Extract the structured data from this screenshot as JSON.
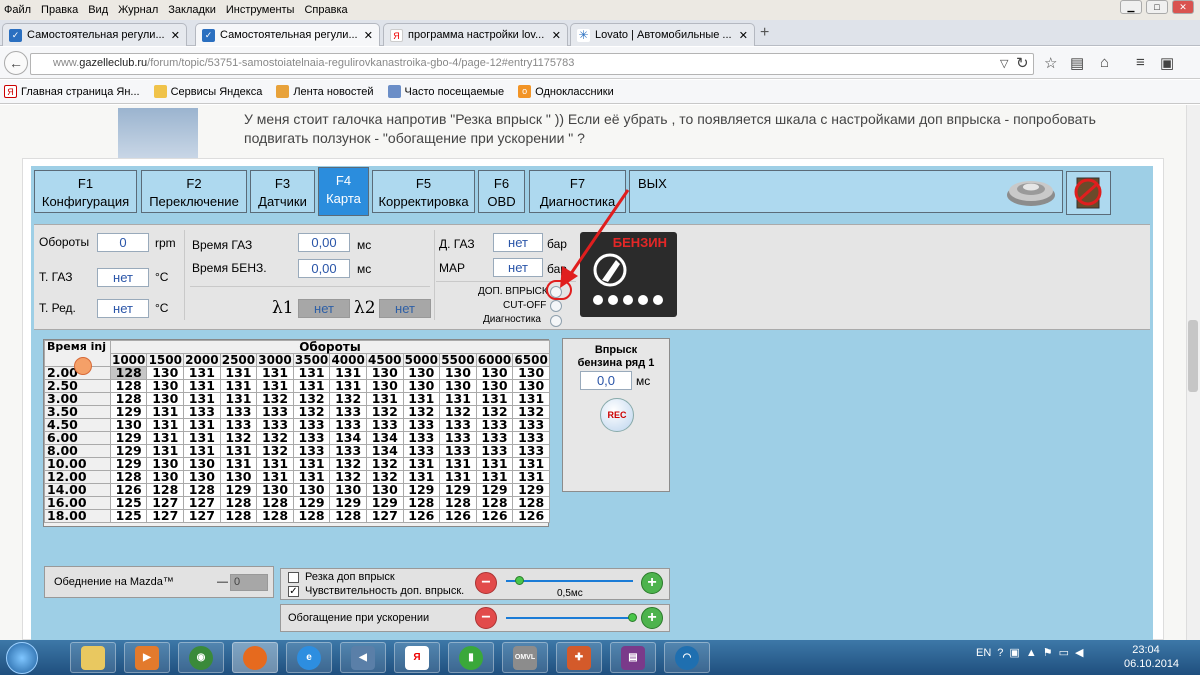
{
  "menubar": {
    "items": [
      "Файл",
      "Правка",
      "Вид",
      "Журнал",
      "Закладки",
      "Инструменты",
      "Справка"
    ]
  },
  "tabs": [
    {
      "title": "Самостоятельная регули...",
      "icon": "gazelle-favicon"
    },
    {
      "title": "Самостоятельная регули...",
      "icon": "gazelle-favicon"
    },
    {
      "title": "программа настройки lov...",
      "icon": "yandex-favicon"
    },
    {
      "title": "Lovato | Автомобильные ...",
      "icon": "lovato-favicon"
    }
  ],
  "url": {
    "prefix": "www.",
    "domain": "gazelleclub.ru",
    "path": "/forum/topic/53751-samostoiatelnaia-regulirovkanastroika-gbo-4/page-12#entry1175783"
  },
  "bookmarks": [
    "Главная страница Ян...",
    "Сервисы Яндекса",
    "Лента новостей",
    "Часто посещаемые",
    "Одноклассники"
  ],
  "forum": {
    "text": "У меня стоит галочка напротив \"Резка впрыск \" )) Если её убрать , то появляется шкала с настройками доп впрыска - попробовать подвигать ползунок - \"обогащение при ускорении \" ?"
  },
  "ftabs": [
    {
      "key": "F1",
      "label": "Конфигурация"
    },
    {
      "key": "F2",
      "label": "Переключение"
    },
    {
      "key": "F3",
      "label": "Датчики"
    },
    {
      "key": "F4",
      "label": "Карта"
    },
    {
      "key": "F5",
      "label": "Корректировка"
    },
    {
      "key": "F6",
      "label": "OBD"
    },
    {
      "key": "F7",
      "label": "Диагностика"
    },
    {
      "key": "",
      "label": "ВЫХ"
    }
  ],
  "panel": {
    "rpm_label": "Обороты",
    "rpm_value": "0",
    "rpm_unit": "rpm",
    "tgaz_label": "Т. ГАЗ",
    "tgaz_value": "нет",
    "tgaz_unit": "°C",
    "tred_label": "Т. Ред.",
    "tred_value": "нет",
    "tred_unit": "°C",
    "vgaz_label": "Время ГАЗ",
    "vgaz_value": "0,00",
    "vgaz_unit": "мс",
    "vbenz_label": "Время БЕНЗ.",
    "vbenz_value": "0,00",
    "vbenz_unit": "мс",
    "lambda1_label": "λ1",
    "lambda1_value": "нет",
    "lambda2_label": "λ2",
    "lambda2_value": "нет",
    "dgaz_label": "Д. ГАЗ",
    "dgaz_value": "нет",
    "dgaz_unit": "бар",
    "map_label": "MAP",
    "map_value": "нет",
    "map_unit": "бар",
    "ind1": "ДОП. ВПРЫСК",
    "ind2": "CUT-OFF",
    "ind3": "Диагностика",
    "fuel_badge": "БЕНЗИН"
  },
  "map": {
    "corner": "Время inj",
    "rpm_header": "Обороты",
    "rpm": [
      "1000",
      "1500",
      "2000",
      "2500",
      "3000",
      "3500",
      "4000",
      "4500",
      "5000",
      "5500",
      "6000",
      "6500"
    ],
    "rows": [
      {
        "t": "2.00",
        "v": [
          "128",
          "130",
          "131",
          "131",
          "131",
          "131",
          "131",
          "130",
          "130",
          "130",
          "130",
          "130"
        ]
      },
      {
        "t": "2.50",
        "v": [
          "128",
          "130",
          "131",
          "131",
          "131",
          "131",
          "131",
          "130",
          "130",
          "130",
          "130",
          "130"
        ]
      },
      {
        "t": "3.00",
        "v": [
          "128",
          "130",
          "131",
          "131",
          "132",
          "132",
          "132",
          "131",
          "131",
          "131",
          "131",
          "131"
        ]
      },
      {
        "t": "3.50",
        "v": [
          "129",
          "131",
          "133",
          "133",
          "133",
          "132",
          "133",
          "132",
          "132",
          "132",
          "132",
          "132"
        ]
      },
      {
        "t": "4.50",
        "v": [
          "130",
          "131",
          "131",
          "133",
          "133",
          "133",
          "133",
          "133",
          "133",
          "133",
          "133",
          "133"
        ]
      },
      {
        "t": "6.00",
        "v": [
          "129",
          "131",
          "131",
          "132",
          "132",
          "133",
          "134",
          "134",
          "133",
          "133",
          "133",
          "133"
        ]
      },
      {
        "t": "8.00",
        "v": [
          "129",
          "131",
          "131",
          "131",
          "132",
          "133",
          "133",
          "134",
          "133",
          "133",
          "133",
          "133"
        ]
      },
      {
        "t": "10.00",
        "v": [
          "129",
          "130",
          "130",
          "131",
          "131",
          "131",
          "132",
          "132",
          "131",
          "131",
          "131",
          "131"
        ]
      },
      {
        "t": "12.00",
        "v": [
          "128",
          "130",
          "130",
          "130",
          "131",
          "131",
          "132",
          "132",
          "131",
          "131",
          "131",
          "131"
        ]
      },
      {
        "t": "14.00",
        "v": [
          "126",
          "128",
          "128",
          "129",
          "130",
          "130",
          "130",
          "130",
          "129",
          "129",
          "129",
          "129"
        ]
      },
      {
        "t": "16.00",
        "v": [
          "125",
          "127",
          "127",
          "128",
          "128",
          "129",
          "129",
          "129",
          "128",
          "128",
          "128",
          "128"
        ]
      },
      {
        "t": "18.00",
        "v": [
          "125",
          "127",
          "127",
          "128",
          "128",
          "128",
          "128",
          "127",
          "126",
          "126",
          "126",
          "126"
        ]
      }
    ]
  },
  "injection": {
    "title1": "Впрыск",
    "title2": "бензина ряд 1",
    "value": "0,0",
    "unit": "мс",
    "rec_label": "REC"
  },
  "mazda": {
    "label": "Обеднение на Mazda™",
    "dash": "—",
    "value": "0"
  },
  "options": {
    "cut_label": "Резка доп впрыск",
    "cut_checked": false,
    "sens_label": "Чувствительность доп. впрыск.",
    "sens_checked": true,
    "slider_value": "0,5мс",
    "accel_label": "Обогащение при ускорении"
  },
  "taskbar": {
    "lang": "EN",
    "time": "23:04",
    "date": "06.10.2014"
  },
  "colors": {
    "app_bg": "#9ecfe6",
    "tab_active": "#2b8ddd",
    "value_text": "#2a55a8",
    "annotation": "#e01e1e"
  }
}
